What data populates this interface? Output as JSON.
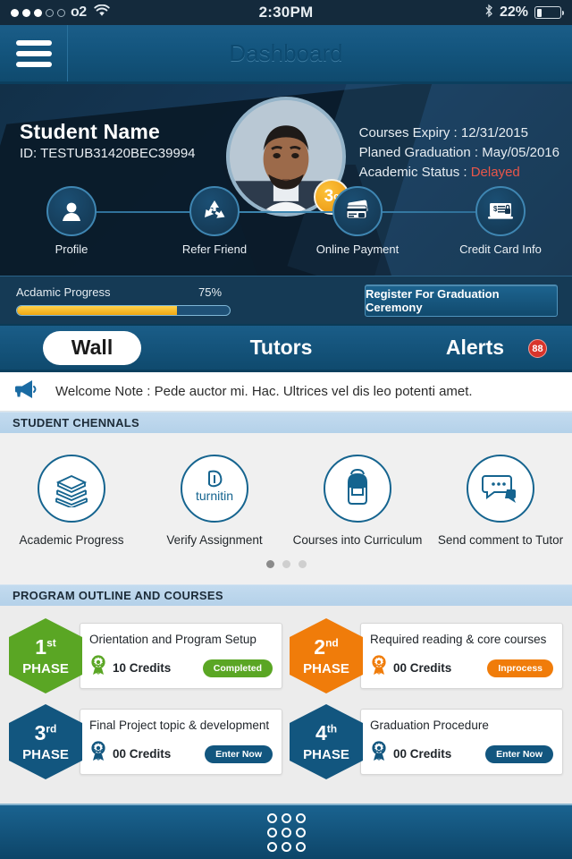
{
  "status_bar": {
    "carrier": "o2",
    "signal_filled": 3,
    "signal_total": 5,
    "time": "2:30PM",
    "battery_percent": "22%",
    "battery_level": 22,
    "wifi_icon": "wifi-icon",
    "bluetooth_icon": "bluetooth-icon"
  },
  "navbar": {
    "menu_icon": "hamburger-menu-icon",
    "title": "Dashboard"
  },
  "profile": {
    "name": "Student Name",
    "id": "ID: TESTUB31420BEC39994",
    "avatar_name": "student-photo",
    "badge": {
      "value": "3",
      "suffix": "c"
    },
    "meta": [
      {
        "label": "Courses Expiry :",
        "value": "12/31/2015",
        "status": false
      },
      {
        "label": "Planed Graduation :",
        "value": "May/05/2016",
        "status": false
      },
      {
        "label": "Academic Status :",
        "value": "Delayed",
        "status": true
      }
    ],
    "status_color": "#e8564a"
  },
  "quick_actions": [
    {
      "label": "Profile",
      "icon": "user-icon"
    },
    {
      "label": "Refer Friend",
      "icon": "recycle-icon"
    },
    {
      "label": "Online Payment",
      "icon": "credit-cards-icon"
    },
    {
      "label": "Credit Card Info",
      "icon": "card-lock-icon"
    }
  ],
  "progress": {
    "label": "Acdamic Progress",
    "percent_text": "75%",
    "percent_value": 75,
    "fill_color": "#f0a712",
    "register_button": "Register For Graduation Ceremony"
  },
  "tabs": [
    {
      "label": "Wall",
      "active": true,
      "badge": null
    },
    {
      "label": "Tutors",
      "active": false,
      "badge": null
    },
    {
      "label": "Alerts",
      "active": false,
      "badge": "88"
    }
  ],
  "welcome": {
    "icon": "megaphone-icon",
    "text": "Welcome Note : Pede auctor mi. Hac. Ultrices vel dis leo potenti amet."
  },
  "sections": {
    "channels_header": "STUDENT CHENNALS",
    "program_header": "PROGRAM OUTLINE AND COURSES"
  },
  "channels": [
    {
      "label": "Academic Progress",
      "icon": "books-stack-icon"
    },
    {
      "label": "Verify Assignment",
      "icon": "turnitin-logo-icon",
      "wordmark": "turnitin"
    },
    {
      "label": "Courses into Curriculum",
      "icon": "backpack-icon"
    },
    {
      "label": "Send comment to Tutor",
      "icon": "chat-bubbles-icon"
    }
  ],
  "pager": {
    "total": 3,
    "active_index": 0
  },
  "phases": [
    {
      "number": "1",
      "ordinal": "st",
      "word": "PHASE",
      "color": "#5aa624",
      "title": "Orientation and Program Setup",
      "credits": "10 Credits",
      "action": "Completed",
      "action_color": "#5aa624",
      "credit_icon": "award-ribbon-icon"
    },
    {
      "number": "2",
      "ordinal": "nd",
      "word": "PHASE",
      "color": "#f07c0a",
      "title": "Required reading & core courses",
      "credits": "00 Credits",
      "action": "Inprocess",
      "action_color": "#f07c0a",
      "credit_icon": "award-ribbon-icon"
    },
    {
      "number": "3",
      "ordinal": "rd",
      "word": "PHASE",
      "color": "#12567f",
      "title": "Final Project topic & development",
      "credits": "00 Credits",
      "action": "Enter Now",
      "action_color": "#12567f",
      "credit_icon": "award-ribbon-icon"
    },
    {
      "number": "4",
      "ordinal": "th",
      "word": "PHASE",
      "color": "#12567f",
      "title": "Graduation Procedure",
      "credits": "00 Credits",
      "action": "Enter Now",
      "action_color": "#12567f",
      "credit_icon": "award-ribbon-icon"
    }
  ],
  "bottom_bar": {
    "icon": "app-grid-icon"
  }
}
